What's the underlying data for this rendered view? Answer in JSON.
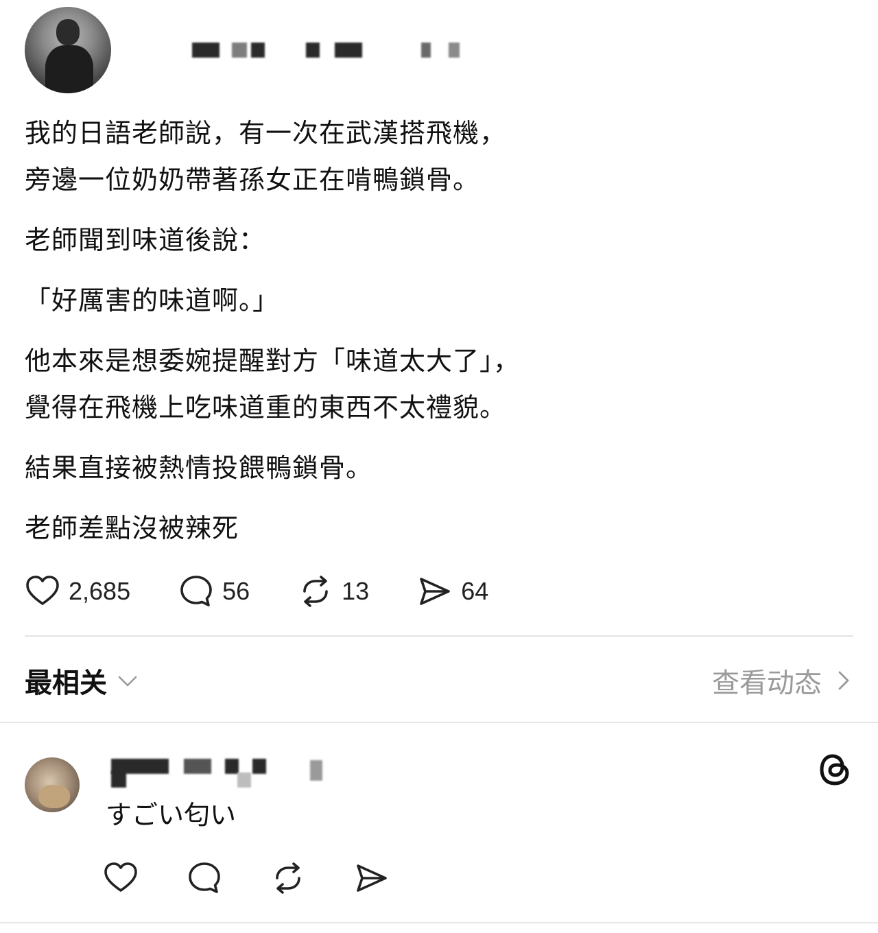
{
  "post": {
    "paragraphs": [
      [
        "我的日語老師說，有一次在武漢搭飛機，",
        "旁邊一位奶奶帶著孫女正在啃鴨鎖骨。"
      ],
      [
        "老師聞到味道後說："
      ],
      [
        "「好厲害的味道啊。」"
      ],
      [
        "他本來是想委婉提醒對方「味道太大了」，",
        "覺得在飛機上吃味道重的東西不太禮貌。"
      ],
      [
        "結果直接被熱情投餵鴨鎖骨。"
      ],
      [
        "老師差點沒被辣死"
      ]
    ],
    "actions": {
      "likes": "2,685",
      "comments": "56",
      "reposts": "13",
      "shares": "64"
    }
  },
  "sort": {
    "label": "最相关",
    "activity_label": "查看动态"
  },
  "reply": {
    "text": "すごい匂い"
  },
  "icons": {
    "like": "heart-icon",
    "comment": "comment-bubble-icon",
    "repost": "repost-icon",
    "share": "send-icon",
    "sort_chevron": "chevron-down-icon",
    "activity_chevron": "chevron-right-icon",
    "threads": "threads-logo-icon"
  }
}
